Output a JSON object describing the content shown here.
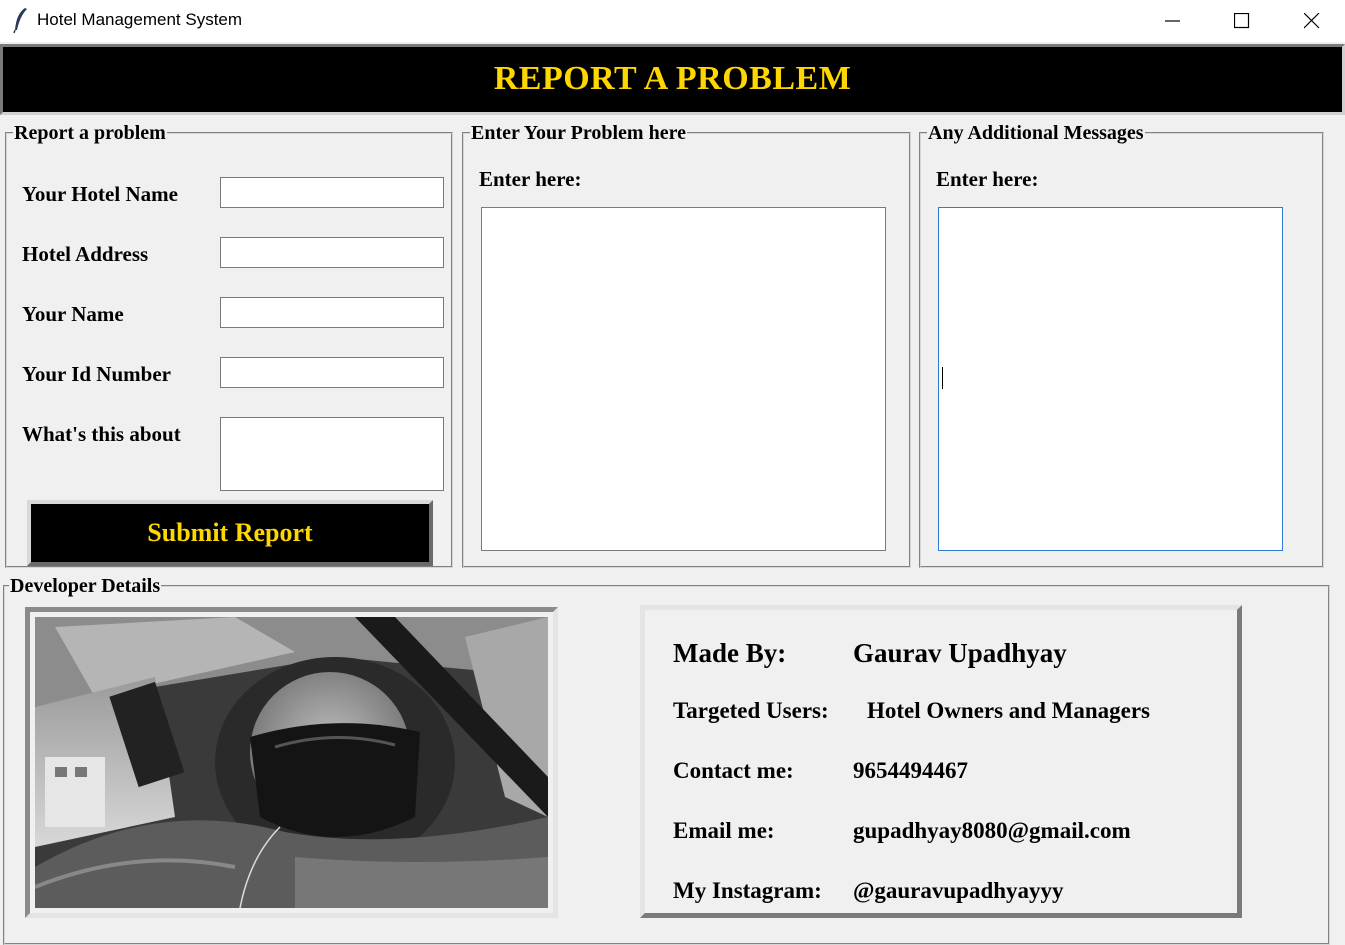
{
  "window": {
    "title": "Hotel Management System"
  },
  "banner": {
    "title": "REPORT A PROBLEM"
  },
  "report_form": {
    "legend": "Report a problem",
    "hotel_name_label": "Your Hotel Name",
    "hotel_address_label": "Hotel Address",
    "your_name_label": "Your Name",
    "id_number_label": "Your Id Number",
    "about_label": "What's this about",
    "submit_label": "Submit Report"
  },
  "problem_panel": {
    "legend": "Enter Your Problem here",
    "prompt": "Enter here:"
  },
  "messages_panel": {
    "legend": "Any Additional Messages",
    "prompt": "Enter here:"
  },
  "developer": {
    "legend": "Developer Details",
    "made_by_label": "Made By:",
    "made_by_value": "Gaurav Upadhyay",
    "users_label": "Targeted Users:",
    "users_value": "Hotel Owners and Managers",
    "contact_label": "Contact me:",
    "contact_value": "9654494467",
    "email_label": "Email me:",
    "email_value": "gupadhyay8080@gmail.com",
    "instagram_label": "My Instagram:",
    "instagram_value": "@gauravupadhyayyy"
  },
  "colors": {
    "banner_bg": "#000000",
    "accent_text": "#ffd700",
    "window_bg": "#f0f0f0",
    "focus_border": "#2a7fd4"
  },
  "icons": {
    "app": "feather-icon",
    "minimize": "minimize-icon",
    "maximize": "maximize-icon",
    "close": "close-icon"
  }
}
